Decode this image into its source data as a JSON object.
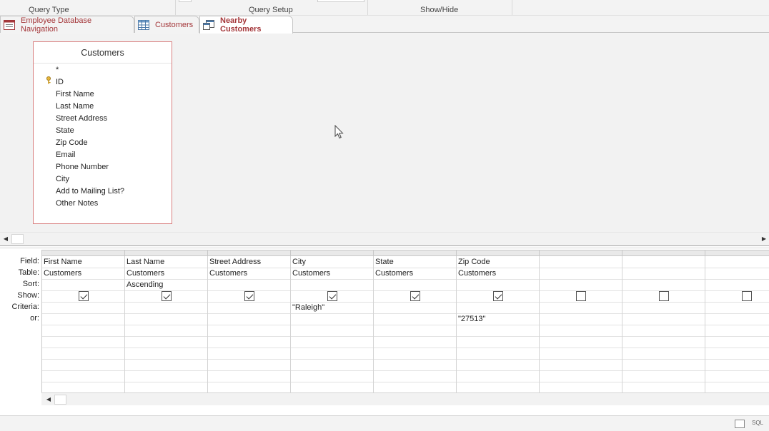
{
  "ribbon": {
    "groups": [
      "Query Type",
      "Query Setup",
      "Show/Hide"
    ]
  },
  "tabs": [
    {
      "label": "Employee Database Navigation",
      "icon": "form-icon",
      "active": false
    },
    {
      "label": "Customers",
      "icon": "table-icon",
      "active": false
    },
    {
      "label": "Nearby Customers",
      "icon": "query-icon",
      "active": true
    }
  ],
  "field_list": {
    "title": "Customers",
    "items": [
      "*",
      "ID",
      "First Name",
      "Last Name",
      "Street Address",
      "State",
      "Zip Code",
      "Email",
      "Phone Number",
      "City",
      "Add to Mailing List?",
      "Other Notes"
    ],
    "primary_key": "ID"
  },
  "grid": {
    "row_labels": [
      "Field:",
      "Table:",
      "Sort:",
      "Show:",
      "Criteria:",
      "or:"
    ],
    "columns": [
      {
        "field": "First Name",
        "table": "Customers",
        "sort": "",
        "show": true,
        "criteria": "",
        "or": ""
      },
      {
        "field": "Last Name",
        "table": "Customers",
        "sort": "Ascending",
        "show": true,
        "criteria": "",
        "or": ""
      },
      {
        "field": "Street Address",
        "table": "Customers",
        "sort": "",
        "show": true,
        "criteria": "",
        "or": ""
      },
      {
        "field": "City",
        "table": "Customers",
        "sort": "",
        "show": true,
        "criteria": "\"Raleigh\"",
        "or": ""
      },
      {
        "field": "State",
        "table": "Customers",
        "sort": "",
        "show": true,
        "criteria": "",
        "or": ""
      },
      {
        "field": "Zip Code",
        "table": "Customers",
        "sort": "",
        "show": true,
        "criteria": "",
        "or": "\"27513\""
      },
      {
        "field": "",
        "table": "",
        "sort": "",
        "show": false,
        "criteria": "",
        "or": ""
      },
      {
        "field": "",
        "table": "",
        "sort": "",
        "show": false,
        "criteria": "",
        "or": ""
      },
      {
        "field": "",
        "table": "",
        "sort": "",
        "show": false,
        "criteria": "",
        "or": ""
      }
    ]
  },
  "status_bar": {
    "view_icons": [
      "datasheet-view-icon"
    ],
    "sql_label": "SQL"
  },
  "colors": {
    "accent": "#a4373a",
    "fieldlist_border": "#d98080"
  }
}
